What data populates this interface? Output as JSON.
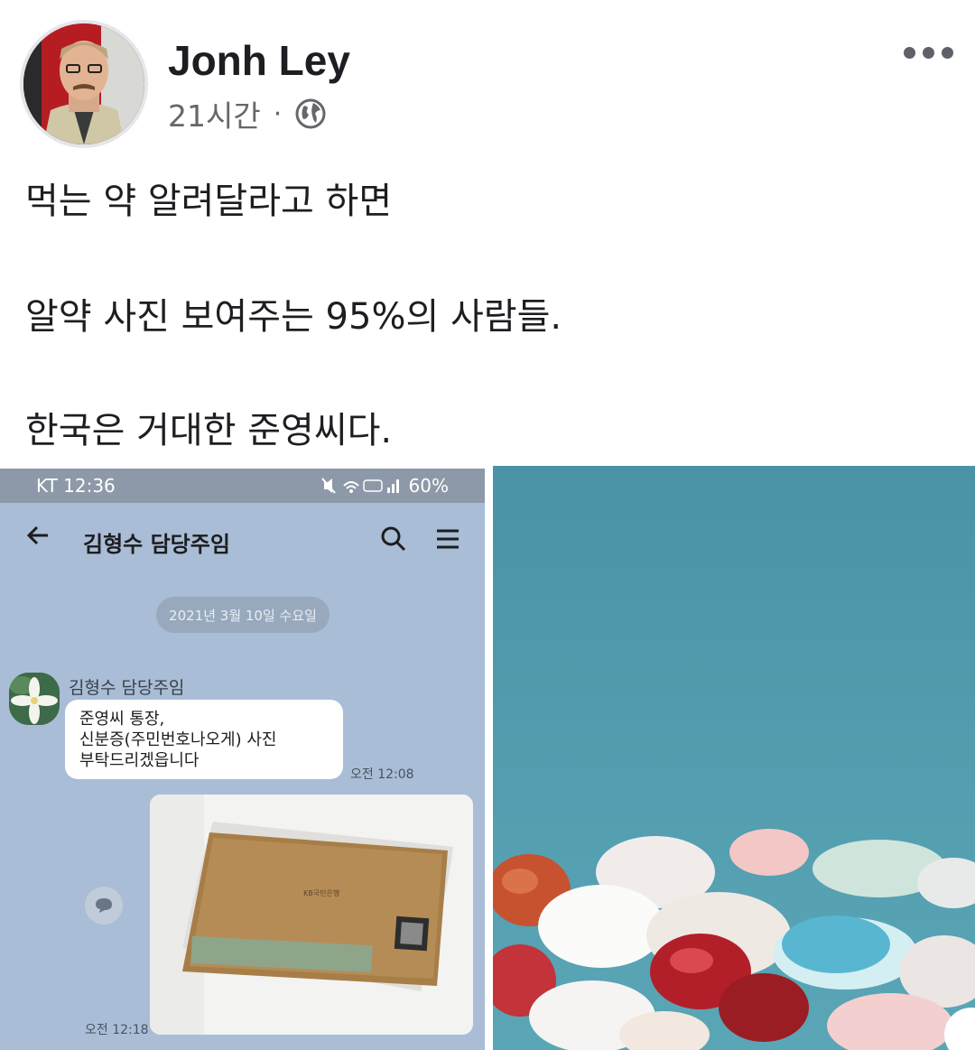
{
  "post": {
    "author": "Jonh Ley",
    "time": "21시간",
    "separator": "·",
    "privacy_icon": "globe-icon",
    "lines": [
      "먹는 약 알려달라고 하면",
      "알약 사진 보여주는 95%의 사람들.",
      "한국은 거대한 준영씨다."
    ]
  },
  "screenshot": {
    "status_left": "KT 12:36",
    "status_right": "60%",
    "chat_title": "김형수 담당주임",
    "date": "2021년 3월 10일 수요일",
    "sender": "김형수 담당주임",
    "message_lines": [
      "준영씨 통장,",
      "신분증(주민번호나오게) 사진",
      "부탁드리겠읍니다"
    ],
    "message_time": "오전 12:08",
    "photo_time": "오전 12:18",
    "card_bank": "KB국민은행"
  },
  "colors": {
    "chat_bg": "#a9bdd6",
    "pill_bg": "#99a9bd",
    "pill_bg_sky": "#4b94a8"
  }
}
